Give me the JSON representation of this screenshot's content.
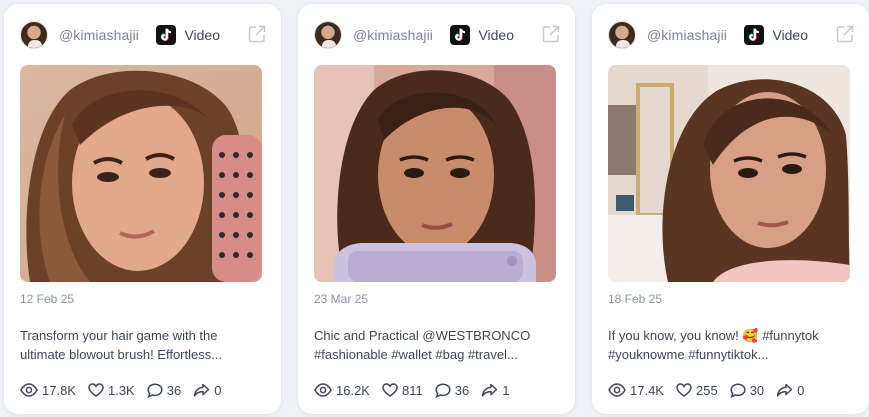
{
  "accent": "#111111",
  "posts": [
    {
      "handle": "@kimiashajii",
      "platform_icon": "tiktok-icon",
      "type": "Video",
      "date": "12 Feb 25",
      "caption_lines": [
        "Transform your hair game with the",
        "ultimate blowout brush! Effortless..."
      ],
      "stats": {
        "views": "17.8K",
        "likes": "1.3K",
        "comments": "36",
        "shares": "0"
      }
    },
    {
      "handle": "@kimiashajii",
      "platform_icon": "tiktok-icon",
      "type": "Video",
      "date": "23 Mar 25",
      "caption_lines": [
        "Chic and Practical @WESTBRONCO",
        "#fashionable #wallet #bag #travel..."
      ],
      "stats": {
        "views": "16.2K",
        "likes": "811",
        "comments": "36",
        "shares": "1"
      }
    },
    {
      "handle": "@kimiashajii",
      "platform_icon": "tiktok-icon",
      "type": "Video",
      "date": "18 Feb 25",
      "caption_lines": [
        "If you know, you know! 🥰 #funnytok",
        "#youknowme #funnytiktok..."
      ],
      "stats": {
        "views": "17.4K",
        "likes": "255",
        "comments": "30",
        "shares": "0"
      }
    }
  ]
}
